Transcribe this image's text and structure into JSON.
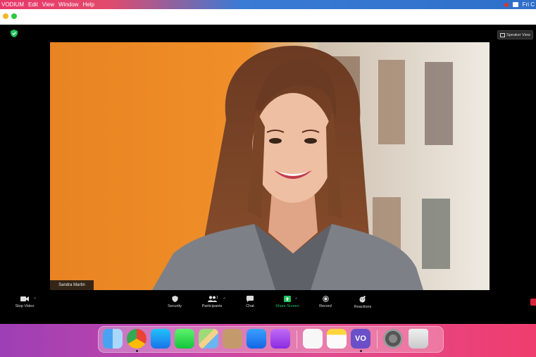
{
  "menubar": {
    "app_name": "VODIUM",
    "items": [
      "Edit",
      "View",
      "Window",
      "Help"
    ],
    "clock": "Fri C"
  },
  "meeting": {
    "view_button": "Speaker View",
    "participant_name": "Sandra Martin"
  },
  "toolbar": {
    "stop_video": "Stop Video",
    "security": "Security",
    "participants": "Participants",
    "participant_count": "1",
    "chat": "Chat",
    "share_screen": "Share Screen",
    "record": "Record",
    "reactions": "Reactions"
  },
  "dock": {
    "apps": [
      "finder",
      "chrome",
      "app-store",
      "messages",
      "maps",
      "contacts",
      "mail",
      "podcasts",
      "reminders",
      "notes",
      "vodium",
      "system-preferences",
      "trash"
    ],
    "vodium_label": "VO"
  },
  "colors": {
    "accent_green": "#22c55e",
    "end_red": "#d8243a"
  }
}
